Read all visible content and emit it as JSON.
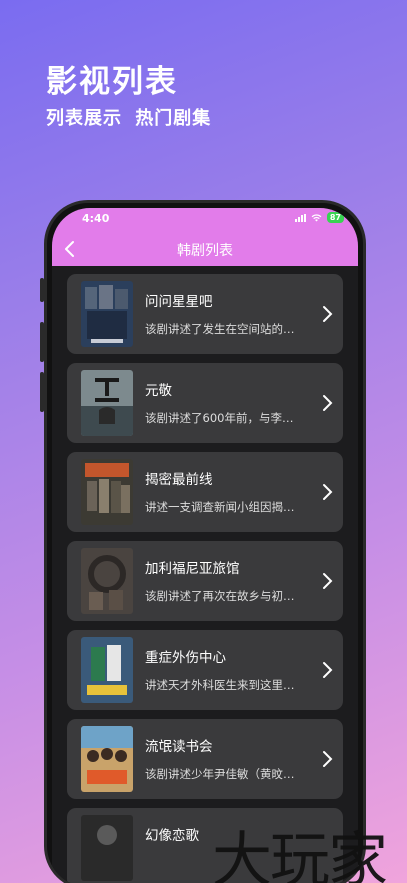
{
  "promo": {
    "title": "影视列表",
    "subtitle": "列表展示 热门剧集"
  },
  "status_bar": {
    "time": "4:40",
    "battery": "87"
  },
  "nav": {
    "title": "韩剧列表"
  },
  "dramas": [
    {
      "title": "问问星星吧",
      "description": "该剧讲述了发生在空间站的…",
      "poster_color": "#2b3f5c"
    },
    {
      "title": "元敬",
      "description": "该剧讲述了600年前，与李…",
      "poster_color": "#5d6a6e"
    },
    {
      "title": "揭密最前线",
      "description": "讲述一支调查新闻小组因揭…",
      "poster_color": "#3c3a33"
    },
    {
      "title": "加利福尼亚旅馆",
      "description": "该剧讲述了再次在故乡与初…",
      "poster_color": "#4a4440"
    },
    {
      "title": "重症外伤中心",
      "description": "讲述天才外科医生来到这里…",
      "poster_color": "#3a5a7a"
    },
    {
      "title": "流氓读书会",
      "description": "该剧讲述少年尹佳敏（黄旼…",
      "poster_color": "#c9a36a"
    },
    {
      "title": "幻像恋歌",
      "description": "",
      "poster_color": "#2a2a2a"
    }
  ],
  "watermark": "大玩家",
  "colors": {
    "header": "#e27cea",
    "card_bg": "#3a3a3c",
    "screen_bg": "#1c1c1e",
    "battery": "#39d353"
  }
}
